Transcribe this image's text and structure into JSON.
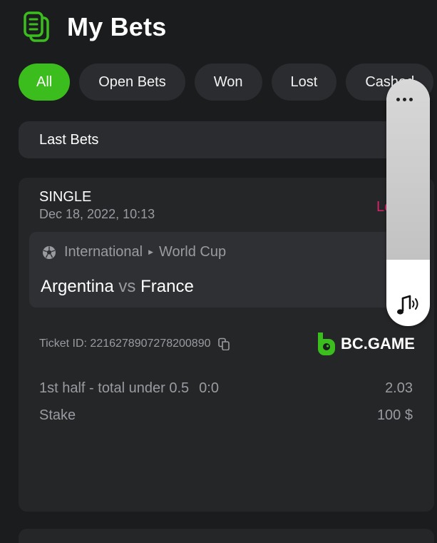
{
  "header": {
    "title": "My Bets"
  },
  "filters": [
    {
      "label": "All",
      "active": true
    },
    {
      "label": "Open Bets",
      "active": false
    },
    {
      "label": "Won",
      "active": false
    },
    {
      "label": "Lost",
      "active": false
    },
    {
      "label": "Cashed",
      "active": false
    }
  ],
  "section": {
    "title": "Last Bets"
  },
  "bet": {
    "type": "SINGLE",
    "date": "Dec 18, 2022, 10:13",
    "status": "Lost",
    "league": "International",
    "competition": "World Cup",
    "home_team": "Argentina",
    "vs": "vs",
    "away_team": "France",
    "ticket_id": "Ticket ID: 2216278907278200890",
    "brand": "BC.GAME",
    "selection": "1st half - total under 0.5",
    "score": "0:0",
    "odds": "2.03",
    "stake_label": "Stake",
    "stake_value": "100 $"
  },
  "colors": {
    "accent": "#3bbd1d",
    "status_lost": "#d8226a",
    "background": "#1b1c1e"
  }
}
